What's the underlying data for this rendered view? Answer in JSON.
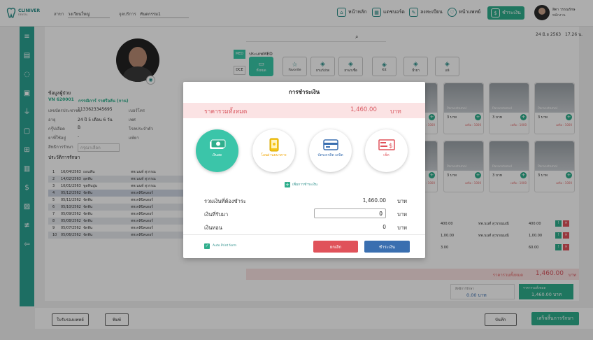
{
  "header": {
    "logo_text": "CLINIVER",
    "logo_sub": "DENTAL",
    "branch_label": "สาขา",
    "branch_value": "วงเวียนใหญ่",
    "service_label": "จุดบริการ",
    "service_value": "ทันตกรรม1",
    "nav": [
      {
        "label": "หน้าหลัก",
        "icon": "home-icon"
      },
      {
        "label": "แดชบอร์ด",
        "icon": "dashboard-icon"
      },
      {
        "label": "ลงทะเบียน",
        "icon": "register-icon"
      },
      {
        "label": "หน้าแพทย์",
        "icon": "doctor-icon"
      },
      {
        "label": "ชำระเงิน",
        "icon": "payment-icon"
      }
    ],
    "user_name": "สิตา วรรณรักษ",
    "user_role": "พนักงาน",
    "date": "24 มิ.ย 2563",
    "time": "17.26 น."
  },
  "patient": {
    "section_title": "ข้อมูลผู้ป่วย",
    "vn": "VN 620001",
    "name": "กรรณิการ์ ราศรีอลัน (กาน)",
    "rows": [
      {
        "label": "เลขบัตรประชาชน",
        "value": "1133623345695",
        "label2": "เบอร์โทร"
      },
      {
        "label": "อายุ",
        "value": "24 ปี 5 เดือน 6 วัน",
        "label2": "เพศ"
      },
      {
        "label": "กรุ๊ปเลือด",
        "value": "B",
        "label2": "โรคประจำตัว"
      },
      {
        "label": "ยาที่ใช้อยู่",
        "value": "-",
        "label2": "แพ้ยา"
      },
      {
        "label": "สิทธิการรักษา",
        "value": "กรุณาเลือก",
        "label2": ""
      }
    ]
  },
  "history": {
    "title": "ประวัติการรักษา",
    "columns": [
      "ลำดับ",
      "วันที่",
      "การรักษา/บริการ",
      "ทันตแพทย์"
    ],
    "rows": [
      [
        "1",
        "16/04/2563",
        "ถอนฟัน",
        "ทพ.นนท์ สุวรรณ",
        ""
      ],
      [
        "2",
        "14/02/2563",
        "อุดฟัน",
        "ทพ.นนท์ สุวรรณ",
        ""
      ],
      [
        "3",
        "10/01/2563",
        "ขูดหินปูน",
        "ทพ.นนท์ สุวรรณ",
        ""
      ],
      [
        "4",
        "05/12/2562",
        "จัดฟัน",
        "ทพ.คลินิคเดอร์",
        ""
      ],
      [
        "5",
        "05/11/2562",
        "จัดฟัน",
        "ทพ.คลินิคเดอร์",
        ""
      ],
      [
        "6",
        "05/10/2562",
        "จัดฟัน",
        "ทพ.คลินิคเดอร์",
        ""
      ],
      [
        "7",
        "05/09/2562",
        "จัดฟัน",
        "ทพ.คลินิคเดอร์",
        "1,000.00"
      ],
      [
        "8",
        "05/08/2562",
        "จัดฟัน",
        "ทพ.คลินิคเดอร์",
        "1,000.00"
      ],
      [
        "9",
        "05/07/2562",
        "จัดฟัน",
        "ทพ.คลินิคเดอร์",
        "1,000.00"
      ],
      [
        "10",
        "05/06/2562",
        "จัดฟัน",
        "ทพ.คลินิคเดอร์",
        "1,000.00"
      ]
    ]
  },
  "catalog": {
    "search_placeholder": "",
    "side_tabs": [
      "MED",
      "DCE"
    ],
    "type_title": "ประเภทMED",
    "tabs": [
      "ทั้งหมด",
      "Favorite",
      "ยาแก้ปวด",
      "ยาฆ่าเชื้อ",
      "Kit",
      "น้ำยา",
      "แพ้"
    ],
    "drug_name": "Paracetamol",
    "drug_price": "3 บาท",
    "drug_remain": "เหลือ : 1000"
  },
  "order": {
    "columns": [
      "ราคา/หน่วย",
      "ทันตแพทย์",
      "ราคา",
      "ตัวเลือก"
    ],
    "rows": [
      [
        "400.00",
        "ทพ.นนท์ สุวรรณมณี",
        "400.00"
      ],
      [
        "1,00.00",
        "ทพ.นนท์ สุวรรณมณี",
        "1,00.00"
      ],
      [
        "3.00",
        "",
        "60.00"
      ]
    ],
    "total_label": "ราคารวมทั้งหมด",
    "total_value": "1,460.00",
    "total_unit": "บาท",
    "right_label": "สิทธิการรักษา",
    "right_value": "0.00 บาท",
    "sum_label": "ราคารวมทั้งหมด",
    "sum_value": "1,460.00 บาท"
  },
  "bottom": {
    "refer_btn": "ใบรับรองแพทย์",
    "print_btn": "พิมพ์",
    "save_btn": "บันทึก",
    "finish_btn": "เสร็จสิ้นการรักษา"
  },
  "modal": {
    "title": "การชำระเงิน",
    "total_label": "ราคารวมทั้งหมด",
    "total_value": "1,460.00",
    "total_unit": "บาท",
    "methods": [
      {
        "label": "เงินสด",
        "icon": "cash-icon",
        "active": true
      },
      {
        "label": "โอนผ่านธนาคาร",
        "icon": "mobile-transfer-icon",
        "active": false
      },
      {
        "label": "บัตรเครดิต เดบิต",
        "icon": "credit-card-icon",
        "active": false
      },
      {
        "label": "เช็ค",
        "icon": "cheque-icon",
        "active": false
      }
    ],
    "add_method": "เพิ่มการชำระเงิน",
    "due_label": "รวมเงินที่ต้องชำระ",
    "due_value": "1,460.00",
    "received_label": "เงินที่รับมา",
    "received_value": "0",
    "change_label": "เงินทอน",
    "change_value": "0",
    "unit": "บาท",
    "autoprint": "Auto Print form",
    "cancel": "ยกเลิก",
    "confirm": "ชำระเงิน"
  },
  "colors": {
    "teal": "#2fae8c",
    "sidebar": "#2ba393",
    "table_header": "#44648e",
    "danger": "#e0525a",
    "primary": "#3a6fb0"
  }
}
